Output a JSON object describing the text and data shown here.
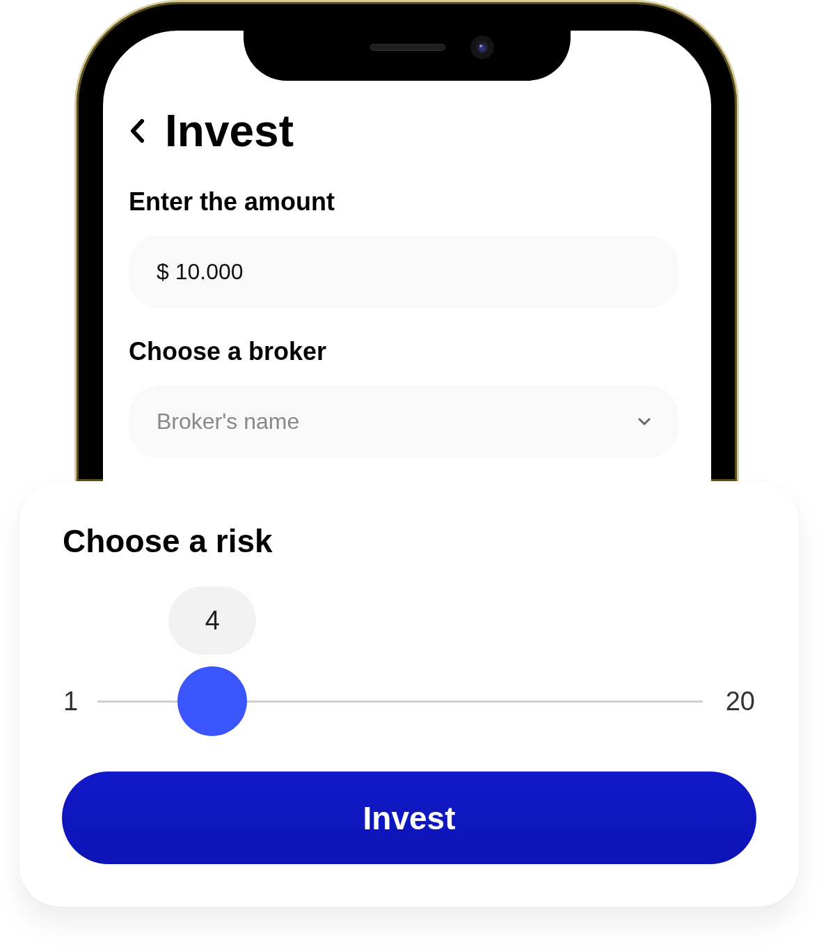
{
  "phone": {
    "title": "Invest",
    "fields": [
      {
        "kind": "input",
        "label": "Enter the amount",
        "value": "$ 10.000"
      },
      {
        "kind": "select",
        "label": "Choose a broker",
        "placeholder": "Broker's name"
      }
    ]
  },
  "risk_panel": {
    "title": "Choose a risk",
    "slider": {
      "value": "4",
      "min_label": "1",
      "max_label": "20",
      "level": 0.19
    },
    "button": "Invest"
  }
}
